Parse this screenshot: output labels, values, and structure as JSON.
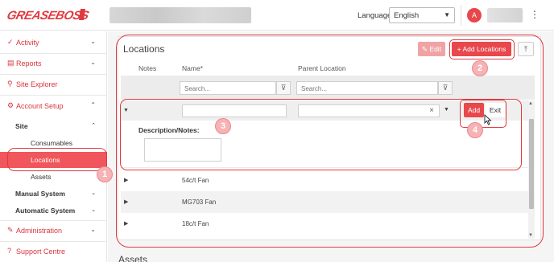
{
  "header": {
    "language_label": "Language:",
    "language_value": "English",
    "avatar_initial": "A"
  },
  "sidebar": {
    "items": [
      {
        "label": "Activity"
      },
      {
        "label": "Reports"
      },
      {
        "label": "Site Explorer"
      },
      {
        "label": "Account Setup"
      }
    ],
    "site_label": "Site",
    "site_children": [
      "Consumables",
      "Locations",
      "Assets"
    ],
    "manual_system": "Manual System",
    "automatic_system": "Automatic System",
    "administration": "Administration",
    "support": "Support Centre"
  },
  "locations": {
    "title": "Locations",
    "edit_label": "Edit",
    "add_locations_label": "+ Add Locations",
    "columns": {
      "notes": "Notes",
      "name": "Name*",
      "parent": "Parent Location"
    },
    "search_placeholder": "Search...",
    "add_label": "Add",
    "exit_label": "Exit",
    "description_label": "Description/Notes:",
    "rows": [
      "54c/t Fan",
      "MG703 Fan",
      "18c/t Fan"
    ]
  },
  "assets_title": "Assets",
  "annotations": [
    "1",
    "2",
    "3",
    "4"
  ],
  "colors": {
    "accent": "#e8474c",
    "annotation": "#e0393f",
    "badge": "#f6b2b4"
  }
}
